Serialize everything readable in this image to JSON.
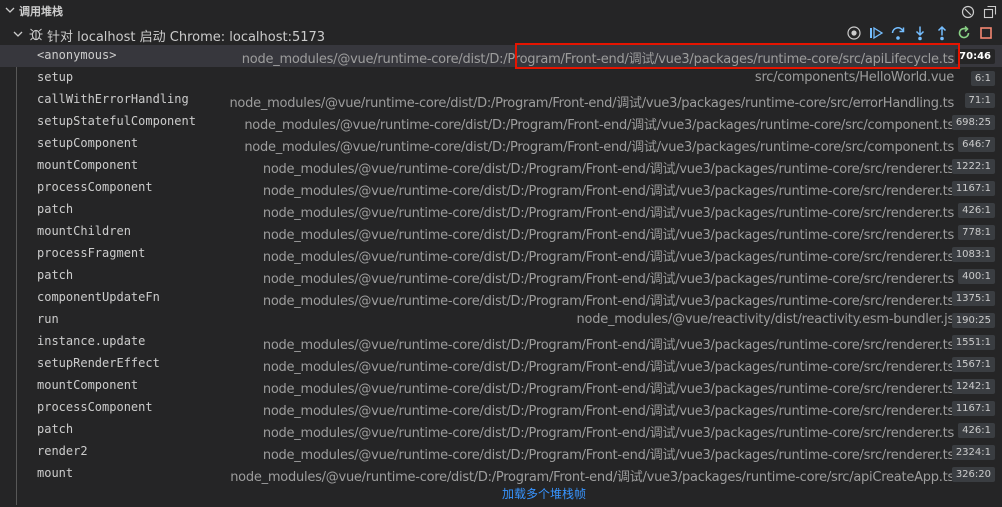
{
  "section": {
    "title": "调用堆栈"
  },
  "session": {
    "label": "针对 localhost 启动 Chrome: localhost:5173"
  },
  "frames": [
    {
      "fn": "<anonymous>",
      "path": "node_modules/@vue/runtime-core/dist/D:/Program/Front-end/调试/vue3/packages/runtime-core/src/apiLifecycle.ts",
      "loc": "70:46",
      "selected": true
    },
    {
      "fn": "setup",
      "path": "src/components/HelloWorld.vue",
      "loc": "6:1"
    },
    {
      "fn": "callWithErrorHandling",
      "path": "node_modules/@vue/runtime-core/dist/D:/Program/Front-end/调试/vue3/packages/runtime-core/src/errorHandling.ts",
      "loc": "71:1"
    },
    {
      "fn": "setupStatefulComponent",
      "path": "node_modules/@vue/runtime-core/dist/D:/Program/Front-end/调试/vue3/packages/runtime-core/src/component.ts",
      "loc": "698:25"
    },
    {
      "fn": "setupComponent",
      "path": "node_modules/@vue/runtime-core/dist/D:/Program/Front-end/调试/vue3/packages/runtime-core/src/component.ts",
      "loc": "646:7"
    },
    {
      "fn": "mountComponent",
      "path": "node_modules/@vue/runtime-core/dist/D:/Program/Front-end/调试/vue3/packages/runtime-core/src/renderer.ts",
      "loc": "1222:1"
    },
    {
      "fn": "processComponent",
      "path": "node_modules/@vue/runtime-core/dist/D:/Program/Front-end/调试/vue3/packages/runtime-core/src/renderer.ts",
      "loc": "1167:1"
    },
    {
      "fn": "patch",
      "path": "node_modules/@vue/runtime-core/dist/D:/Program/Front-end/调试/vue3/packages/runtime-core/src/renderer.ts",
      "loc": "426:1"
    },
    {
      "fn": "mountChildren",
      "path": "node_modules/@vue/runtime-core/dist/D:/Program/Front-end/调试/vue3/packages/runtime-core/src/renderer.ts",
      "loc": "778:1"
    },
    {
      "fn": "processFragment",
      "path": "node_modules/@vue/runtime-core/dist/D:/Program/Front-end/调试/vue3/packages/runtime-core/src/renderer.ts",
      "loc": "1083:1"
    },
    {
      "fn": "patch",
      "path": "node_modules/@vue/runtime-core/dist/D:/Program/Front-end/调试/vue3/packages/runtime-core/src/renderer.ts",
      "loc": "400:1"
    },
    {
      "fn": "componentUpdateFn",
      "path": "node_modules/@vue/runtime-core/dist/D:/Program/Front-end/调试/vue3/packages/runtime-core/src/renderer.ts",
      "loc": "1375:1"
    },
    {
      "fn": "run",
      "path": "node_modules/@vue/reactivity/dist/reactivity.esm-bundler.js",
      "loc": "190:25"
    },
    {
      "fn": "instance.update",
      "path": "node_modules/@vue/runtime-core/dist/D:/Program/Front-end/调试/vue3/packages/runtime-core/src/renderer.ts",
      "loc": "1551:1"
    },
    {
      "fn": "setupRenderEffect",
      "path": "node_modules/@vue/runtime-core/dist/D:/Program/Front-end/调试/vue3/packages/runtime-core/src/renderer.ts",
      "loc": "1567:1"
    },
    {
      "fn": "mountComponent",
      "path": "node_modules/@vue/runtime-core/dist/D:/Program/Front-end/调试/vue3/packages/runtime-core/src/renderer.ts",
      "loc": "1242:1"
    },
    {
      "fn": "processComponent",
      "path": "node_modules/@vue/runtime-core/dist/D:/Program/Front-end/调试/vue3/packages/runtime-core/src/renderer.ts",
      "loc": "1167:1"
    },
    {
      "fn": "patch",
      "path": "node_modules/@vue/runtime-core/dist/D:/Program/Front-end/调试/vue3/packages/runtime-core/src/renderer.ts",
      "loc": "426:1"
    },
    {
      "fn": "render2",
      "path": "node_modules/@vue/runtime-core/dist/D:/Program/Front-end/调试/vue3/packages/runtime-core/src/renderer.ts",
      "loc": "2324:1"
    },
    {
      "fn": "mount",
      "path": "node_modules/@vue/runtime-core/dist/D:/Program/Front-end/调试/vue3/packages/runtime-core/src/apiCreateApp.ts",
      "loc": "326:20"
    }
  ],
  "load_more": "加载多个堆栈帧",
  "colors": {
    "background": "#252526",
    "selected_row": "#37373d",
    "highlight_border": "#e51400",
    "link": "#3794ff",
    "toolbar_blue": "#75beff",
    "restart_green": "#89d185",
    "stop_red": "#f48771"
  },
  "icons": {
    "header": [
      "chevron-down-icon",
      "clear-all-icon",
      "collapse-all-icon"
    ],
    "session": [
      "chevron-down-icon",
      "debug-icon"
    ],
    "toolbar": [
      "record-icon",
      "continue-icon",
      "step-over-icon",
      "step-into-icon",
      "step-out-icon",
      "restart-icon",
      "stop-icon"
    ]
  }
}
